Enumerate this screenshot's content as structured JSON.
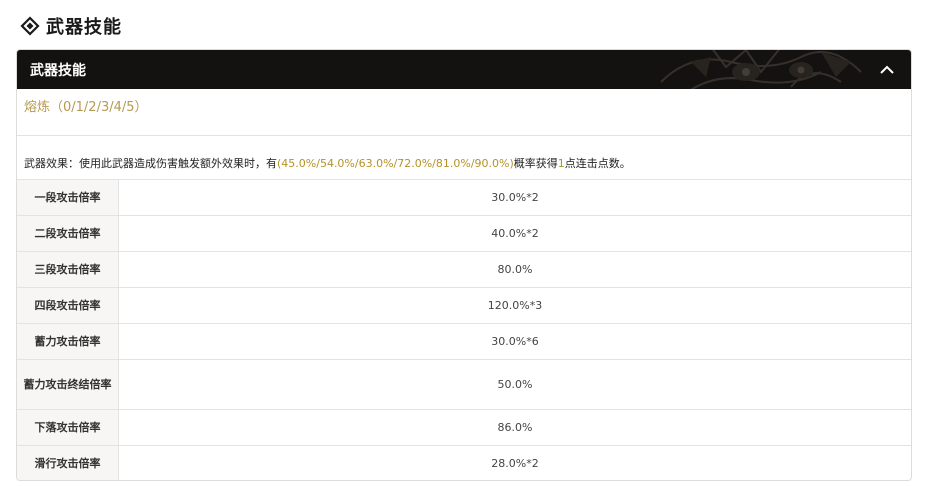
{
  "section": {
    "title": "武器技能",
    "icon": "diamond-icon"
  },
  "panel": {
    "header_title": "武器技能",
    "collapse_icon": "chevron-up-icon",
    "refine_label": "熔炼（0/1/2/3/4/5）",
    "effect": {
      "prefix": "武器效果：使用此武器造成伤害触发额外效果时，有",
      "chance": "(45.0%/54.0%/63.0%/72.0%/81.0%/90.0%)",
      "middle": "概率获得",
      "count": "1",
      "suffix": "点连击点数。"
    },
    "rows": [
      {
        "label": "一段攻击倍率",
        "value": "30.0%*2"
      },
      {
        "label": "二段攻击倍率",
        "value": "40.0%*2"
      },
      {
        "label": "三段攻击倍率",
        "value": "80.0%"
      },
      {
        "label": "四段攻击倍率",
        "value": "120.0%*3"
      },
      {
        "label": "蓄力攻击倍率",
        "value": "30.0%*6"
      },
      {
        "label": "蓄力攻击终结倍率",
        "value": "50.0%"
      },
      {
        "label": "下落攻击倍率",
        "value": "86.0%"
      },
      {
        "label": "滑行攻击倍率",
        "value": "28.0%*2"
      }
    ]
  },
  "colors": {
    "header_bg": "#141210",
    "refine_gold": "#b69a52",
    "chance_gold": "#b59225",
    "label_bg": "#f7f6f4"
  }
}
